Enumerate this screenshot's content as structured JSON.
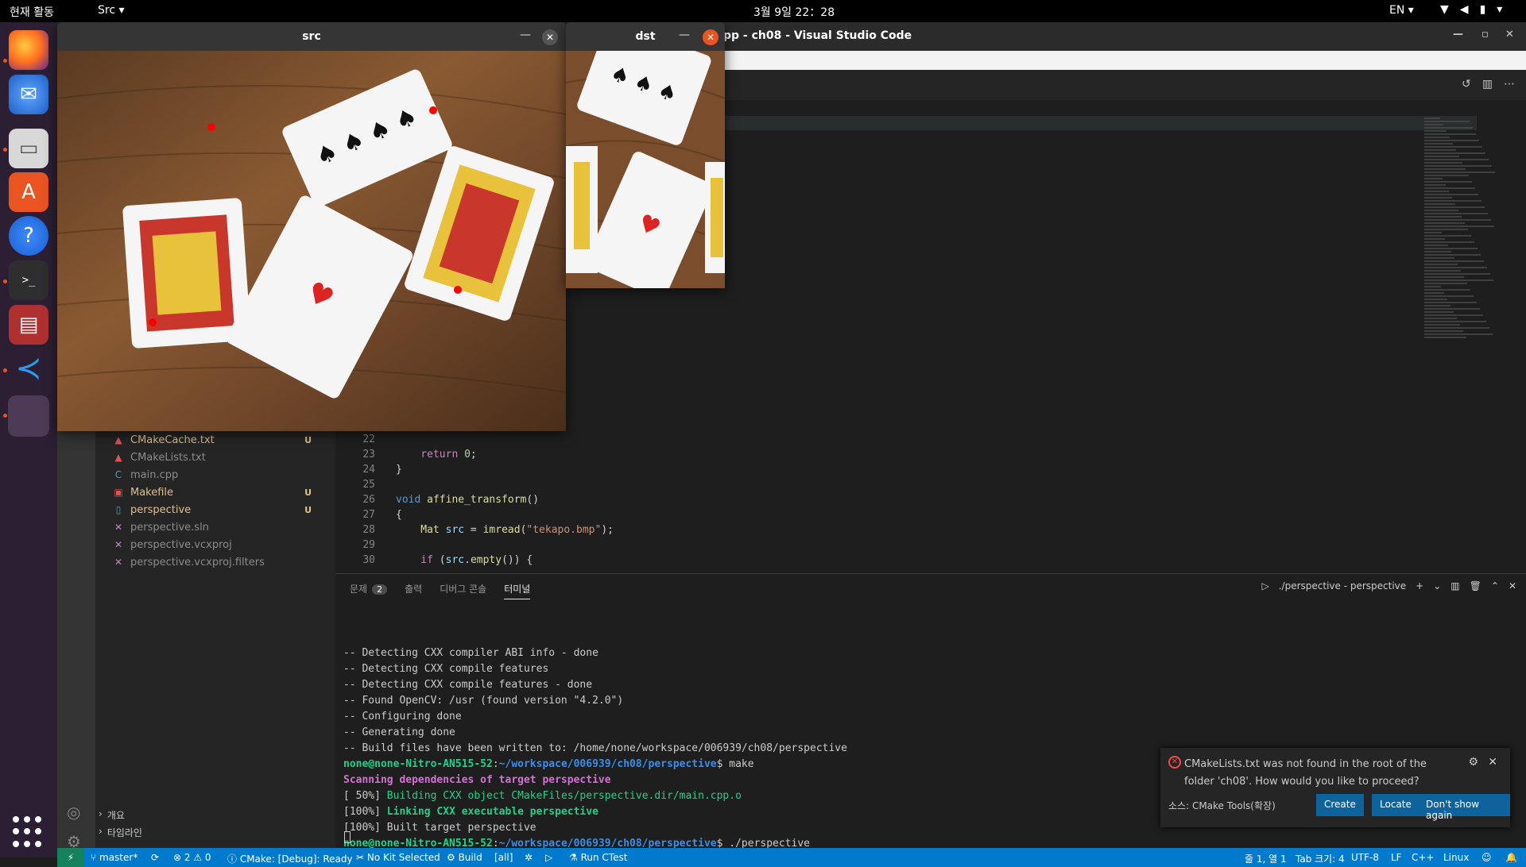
{
  "topbar": {
    "activities": "현재 활동",
    "app_menu": "Src ▾",
    "clock": "3월 9일 22：28",
    "lang": "EN ▾"
  },
  "dock": {
    "items": [
      "firefox-icon",
      "thunderbird-icon",
      "files-icon",
      "software-icon",
      "help-icon",
      "terminal-icon",
      "app-icon",
      "vscode-icon",
      "active-app-icon"
    ]
  },
  "vscode": {
    "title": "pp - ch08 - Visual Studio Code",
    "files": [
      {
        "name": "CMakeCache.txt",
        "badge": "U",
        "color": "#e2c08d"
      },
      {
        "name": "CMakeLists.txt",
        "badge": "",
        "color": "#8c8c8c"
      },
      {
        "name": "main.cpp",
        "badge": "",
        "color": "#8c8c8c"
      },
      {
        "name": "Makefile",
        "badge": "U",
        "color": "#e2c08d"
      },
      {
        "name": "perspective",
        "badge": "U",
        "color": "#e2c08d"
      },
      {
        "name": "perspective.sln",
        "badge": "",
        "color": "#8c8c8c"
      },
      {
        "name": "perspective.vcxproj",
        "badge": "",
        "color": "#8c8c8c"
      },
      {
        "name": "perspective.vcxproj.filters",
        "badge": "",
        "color": "#8c8c8c"
      }
    ],
    "sidebar_sections": [
      "개요",
      "타임라인"
    ],
    "code": [
      {
        "ln": "22",
        "text": ""
      },
      {
        "ln": "23",
        "text": "    return 0;"
      },
      {
        "ln": "24",
        "text": "}"
      },
      {
        "ln": "25",
        "text": ""
      },
      {
        "ln": "26",
        "text": "void affine_transform()"
      },
      {
        "ln": "27",
        "text": "{"
      },
      {
        "ln": "28",
        "text": "    Mat src = imread(\"tekapo.bmp\");"
      },
      {
        "ln": "29",
        "text": ""
      },
      {
        "ln": "30",
        "text": "    if (src.empty()) {"
      }
    ],
    "panel": {
      "tabs": [
        "문제",
        "출력",
        "디버그 콘솔",
        "터미널"
      ],
      "problem_count": "2",
      "terminal_name": "./perspective - perspective"
    },
    "terminal": [
      "-- Detecting CXX compiler ABI info - done",
      "-- Detecting CXX compile features",
      "-- Detecting CXX compile features - done",
      "-- Found OpenCV: /usr (found version \"4.2.0\")",
      "-- Configuring done",
      "-- Generating done",
      "-- Build files have been written to: /home/none/workspace/006939/ch08/perspective"
    ],
    "prompt_user": "none@none-Nitro-AN515-52",
    "prompt_path": "~/workspace/006939/ch08/perspective",
    "cmd_make": "$ make",
    "scanning": "Scanning dependencies of target perspective",
    "build_pct1": "[ 50%]",
    "build_msg1": "Building CXX object CMakeFiles/perspective.dir/main.cpp.o",
    "build_pct2": "[100%]",
    "build_msg2": "Linking CXX executable perspective",
    "build_line3": "[100%] Built target perspective",
    "cmd_run": "$ ./perspective",
    "notification": {
      "message": "CMakeLists.txt was not found in the root of the folder 'ch08'. How would you like to proceed?",
      "source": "소스: CMake Tools(확장)",
      "btn_create": "Create",
      "btn_locate": "Locate",
      "btn_dont_show": "Don't show again"
    },
    "status": {
      "branch": "master*",
      "errors": "⊗ 2 ⚠ 0",
      "cmake": "CMake: [Debug]: Ready",
      "kit": "No Kit Selected",
      "build": "Build",
      "target": "[all]",
      "ctest": "Run CTest",
      "position": "줄 1, 열 1",
      "tab": "Tab 크기: 4",
      "encoding": "UTF-8",
      "eol": "LF",
      "lang": "C++",
      "os": "Linux"
    }
  },
  "windows": {
    "src": {
      "title": "src"
    },
    "dst": {
      "title": "dst"
    }
  }
}
